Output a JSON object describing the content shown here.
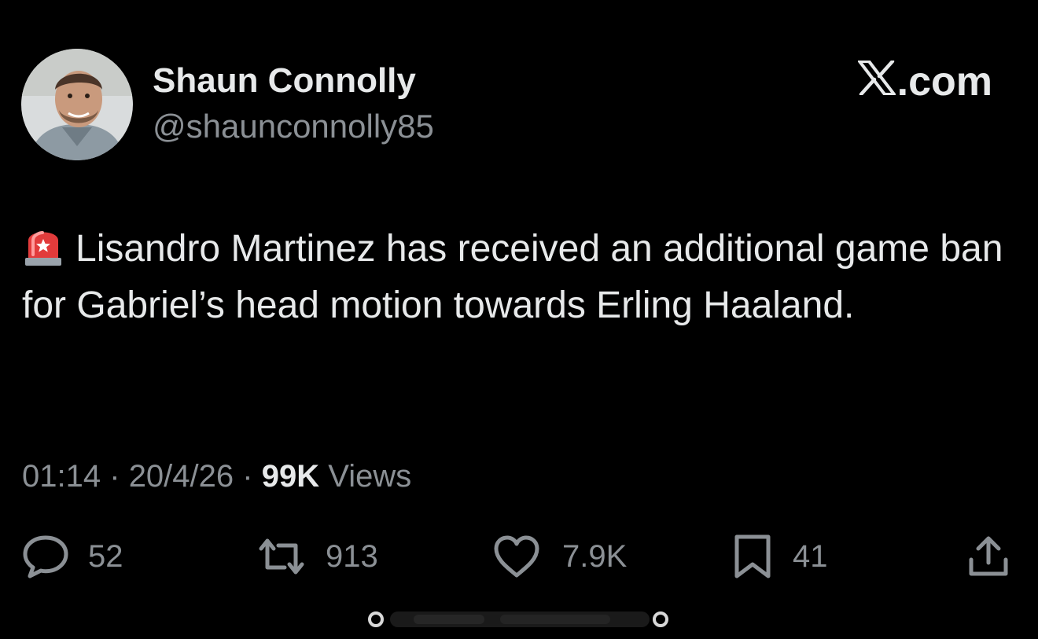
{
  "author": {
    "display_name": "Shaun Connolly",
    "handle": "@shaunconnolly85",
    "avatar_icon": "person-avatar"
  },
  "brand": {
    "label": ".com",
    "icon": "x-logo-icon"
  },
  "tweet": {
    "text": "Lisandro Martinez has received an additional game ban for Gabriel’s head motion towards Erling Haaland.",
    "leading_emoji_icon": "police-siren-icon"
  },
  "meta": {
    "time": "01:14",
    "separator": "·",
    "date": "20/4/26",
    "views_count": "99K",
    "views_label": "Views"
  },
  "actions": {
    "replies": {
      "icon": "reply-icon",
      "count": "52"
    },
    "reposts": {
      "icon": "repost-icon",
      "count": "913"
    },
    "likes": {
      "icon": "like-icon",
      "count": "7.9K"
    },
    "bookmarks": {
      "icon": "bookmark-icon",
      "count": "41"
    },
    "share": {
      "icon": "share-icon"
    }
  },
  "colors": {
    "background": "#000000",
    "primary_text": "#e7e9ea",
    "secondary_text": "#8b9095",
    "siren_red": "#e23b3b"
  }
}
